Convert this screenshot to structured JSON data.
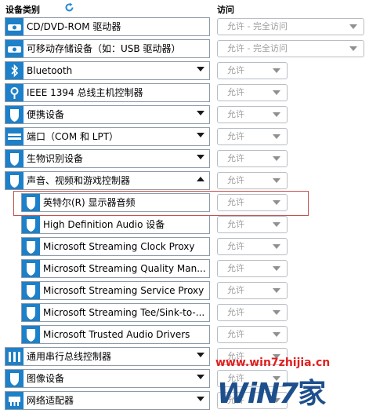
{
  "header": {
    "category_label": "设备类别",
    "access_label": "访问"
  },
  "devices": [
    {
      "label": "CD/DVD-ROM 驱动器",
      "icon": "disc-drive-icon",
      "indent": 0,
      "arrow": "none",
      "access": "允许 - 完全访问",
      "select": "wide"
    },
    {
      "label": "可移动存储设备（如：USB 驱动器）",
      "icon": "removable-disk-icon",
      "indent": 0,
      "arrow": "none",
      "access": "允许 - 完全访问",
      "select": "wide"
    },
    {
      "label": "Bluetooth",
      "icon": "bluetooth-icon",
      "indent": 0,
      "arrow": "down",
      "access": "允许",
      "select": "narrow"
    },
    {
      "label": "IEEE 1394 总线主机控制器",
      "icon": "firewire-icon",
      "indent": 0,
      "arrow": "none",
      "access": "允许",
      "select": "narrow"
    },
    {
      "label": "便携设备",
      "icon": "shield-icon",
      "indent": 0,
      "arrow": "down",
      "access": "允许",
      "select": "narrow"
    },
    {
      "label": "端口（COM 和 LPT）",
      "icon": "port-icon",
      "indent": 0,
      "arrow": "down",
      "access": "允许",
      "select": "narrow"
    },
    {
      "label": "生物识别设备",
      "icon": "shield-icon",
      "indent": 0,
      "arrow": "down",
      "access": "允许",
      "select": "narrow"
    },
    {
      "label": "声音、视频和游戏控制器",
      "icon": "shield-icon",
      "indent": 0,
      "arrow": "up",
      "access": "允许",
      "select": "narrow"
    },
    {
      "label": "英特尔(R) 显示器音频",
      "icon": "shield-icon",
      "indent": 1,
      "arrow": "none",
      "access": "允许",
      "select": "narrow"
    },
    {
      "label": "High Definition Audio 设备",
      "icon": "shield-icon",
      "indent": 1,
      "arrow": "none",
      "access": "允许",
      "select": "narrow"
    },
    {
      "label": "Microsoft Streaming Clock Proxy",
      "icon": "shield-icon",
      "indent": 1,
      "arrow": "none",
      "access": "允许",
      "select": "narrow"
    },
    {
      "label": "Microsoft Streaming Quality Man...",
      "icon": "shield-icon",
      "indent": 1,
      "arrow": "none",
      "access": "允许",
      "select": "narrow"
    },
    {
      "label": "Microsoft Streaming Service Proxy",
      "icon": "shield-icon",
      "indent": 1,
      "arrow": "none",
      "access": "允许",
      "select": "narrow"
    },
    {
      "label": "Microsoft Streaming Tee/Sink-to-...",
      "icon": "shield-icon",
      "indent": 1,
      "arrow": "none",
      "access": "允许",
      "select": "narrow"
    },
    {
      "label": "Microsoft Trusted Audio Drivers",
      "icon": "shield-icon",
      "indent": 1,
      "arrow": "none",
      "access": "允许",
      "select": "narrow"
    },
    {
      "label": "通用串行总线控制器",
      "icon": "usb-icon",
      "indent": 0,
      "arrow": "down",
      "access": "允许",
      "select": "narrow"
    },
    {
      "label": "图像设备",
      "icon": "shield-icon",
      "indent": 0,
      "arrow": "down",
      "access": "允许",
      "select": "narrow"
    },
    {
      "label": "网络适配器",
      "icon": "network-adapter-icon",
      "indent": 0,
      "arrow": "down",
      "access": "允许",
      "select": "narrow"
    }
  ],
  "watermark": {
    "url": "www.win7zhijia.cn",
    "logo": "WiN7",
    "logo_suffix": "家"
  },
  "colors": {
    "icon_bg": "#1e80c8",
    "highlight_border": "#c0504d",
    "watermark_red": "#e02020",
    "watermark_blue": "#1d4f8c"
  }
}
